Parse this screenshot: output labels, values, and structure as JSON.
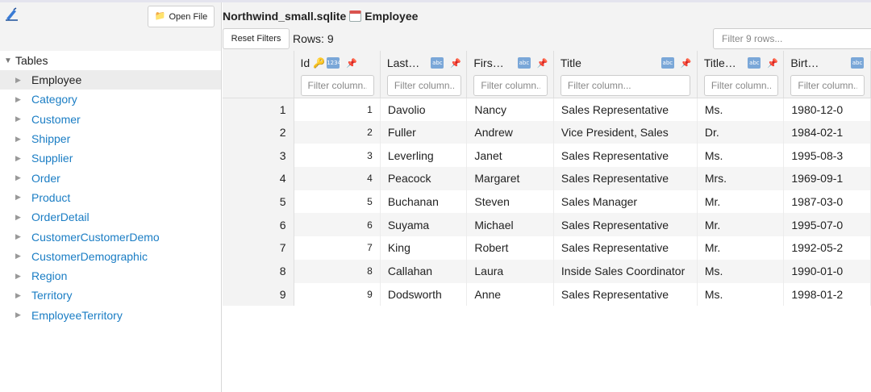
{
  "app": {
    "open_file_label": "Open File"
  },
  "sidebar": {
    "root_label": "Tables",
    "items": [
      {
        "label": "Employee"
      },
      {
        "label": "Category"
      },
      {
        "label": "Customer"
      },
      {
        "label": "Shipper"
      },
      {
        "label": "Supplier"
      },
      {
        "label": "Order"
      },
      {
        "label": "Product"
      },
      {
        "label": "OrderDetail"
      },
      {
        "label": "CustomerCustomerDemo"
      },
      {
        "label": "CustomerDemographic"
      },
      {
        "label": "Region"
      },
      {
        "label": "Territory"
      },
      {
        "label": "EmployeeTerritory"
      }
    ]
  },
  "header": {
    "db_name": "Northwind_small.sqlite",
    "table_name": "Employee",
    "reset_filters_label": "Reset Filters",
    "rows_label": "Rows:",
    "rows_count": "9",
    "filter_rows_placeholder": "Filter 9 rows..."
  },
  "grid": {
    "columns": [
      {
        "name": "Id",
        "filter_placeholder": "Filter column..."
      },
      {
        "name": "Last…",
        "filter_placeholder": "Filter column..."
      },
      {
        "name": "Firs…",
        "filter_placeholder": "Filter column..."
      },
      {
        "name": "Title",
        "filter_placeholder": "Filter column..."
      },
      {
        "name": "Title…",
        "filter_placeholder": "Filter column..."
      },
      {
        "name": "Birt…",
        "filter_placeholder": "Filter column..."
      }
    ],
    "rows": [
      {
        "num": "1",
        "id": "1",
        "last": "Davolio",
        "first": "Nancy",
        "title": "Sales Representative",
        "courtesy": "Ms.",
        "birth": "1980-12-0"
      },
      {
        "num": "2",
        "id": "2",
        "last": "Fuller",
        "first": "Andrew",
        "title": "Vice President, Sales",
        "courtesy": "Dr.",
        "birth": "1984-02-1"
      },
      {
        "num": "3",
        "id": "3",
        "last": "Leverling",
        "first": "Janet",
        "title": "Sales Representative",
        "courtesy": "Ms.",
        "birth": "1995-08-3"
      },
      {
        "num": "4",
        "id": "4",
        "last": "Peacock",
        "first": "Margaret",
        "title": "Sales Representative",
        "courtesy": "Mrs.",
        "birth": "1969-09-1"
      },
      {
        "num": "5",
        "id": "5",
        "last": "Buchanan",
        "first": "Steven",
        "title": "Sales Manager",
        "courtesy": "Mr.",
        "birth": "1987-03-0"
      },
      {
        "num": "6",
        "id": "6",
        "last": "Suyama",
        "first": "Michael",
        "title": "Sales Representative",
        "courtesy": "Mr.",
        "birth": "1995-07-0"
      },
      {
        "num": "7",
        "id": "7",
        "last": "King",
        "first": "Robert",
        "title": "Sales Representative",
        "courtesy": "Mr.",
        "birth": "1992-05-2"
      },
      {
        "num": "8",
        "id": "8",
        "last": "Callahan",
        "first": "Laura",
        "title": "Inside Sales Coordinator",
        "courtesy": "Ms.",
        "birth": "1990-01-0"
      },
      {
        "num": "9",
        "id": "9",
        "last": "Dodsworth",
        "first": "Anne",
        "title": "Sales Representative",
        "courtesy": "Ms.",
        "birth": "1998-01-2"
      }
    ]
  },
  "colors": {
    "link": "#1a7dc4",
    "panel": "#f3f3f3",
    "selected": "#ececec"
  }
}
